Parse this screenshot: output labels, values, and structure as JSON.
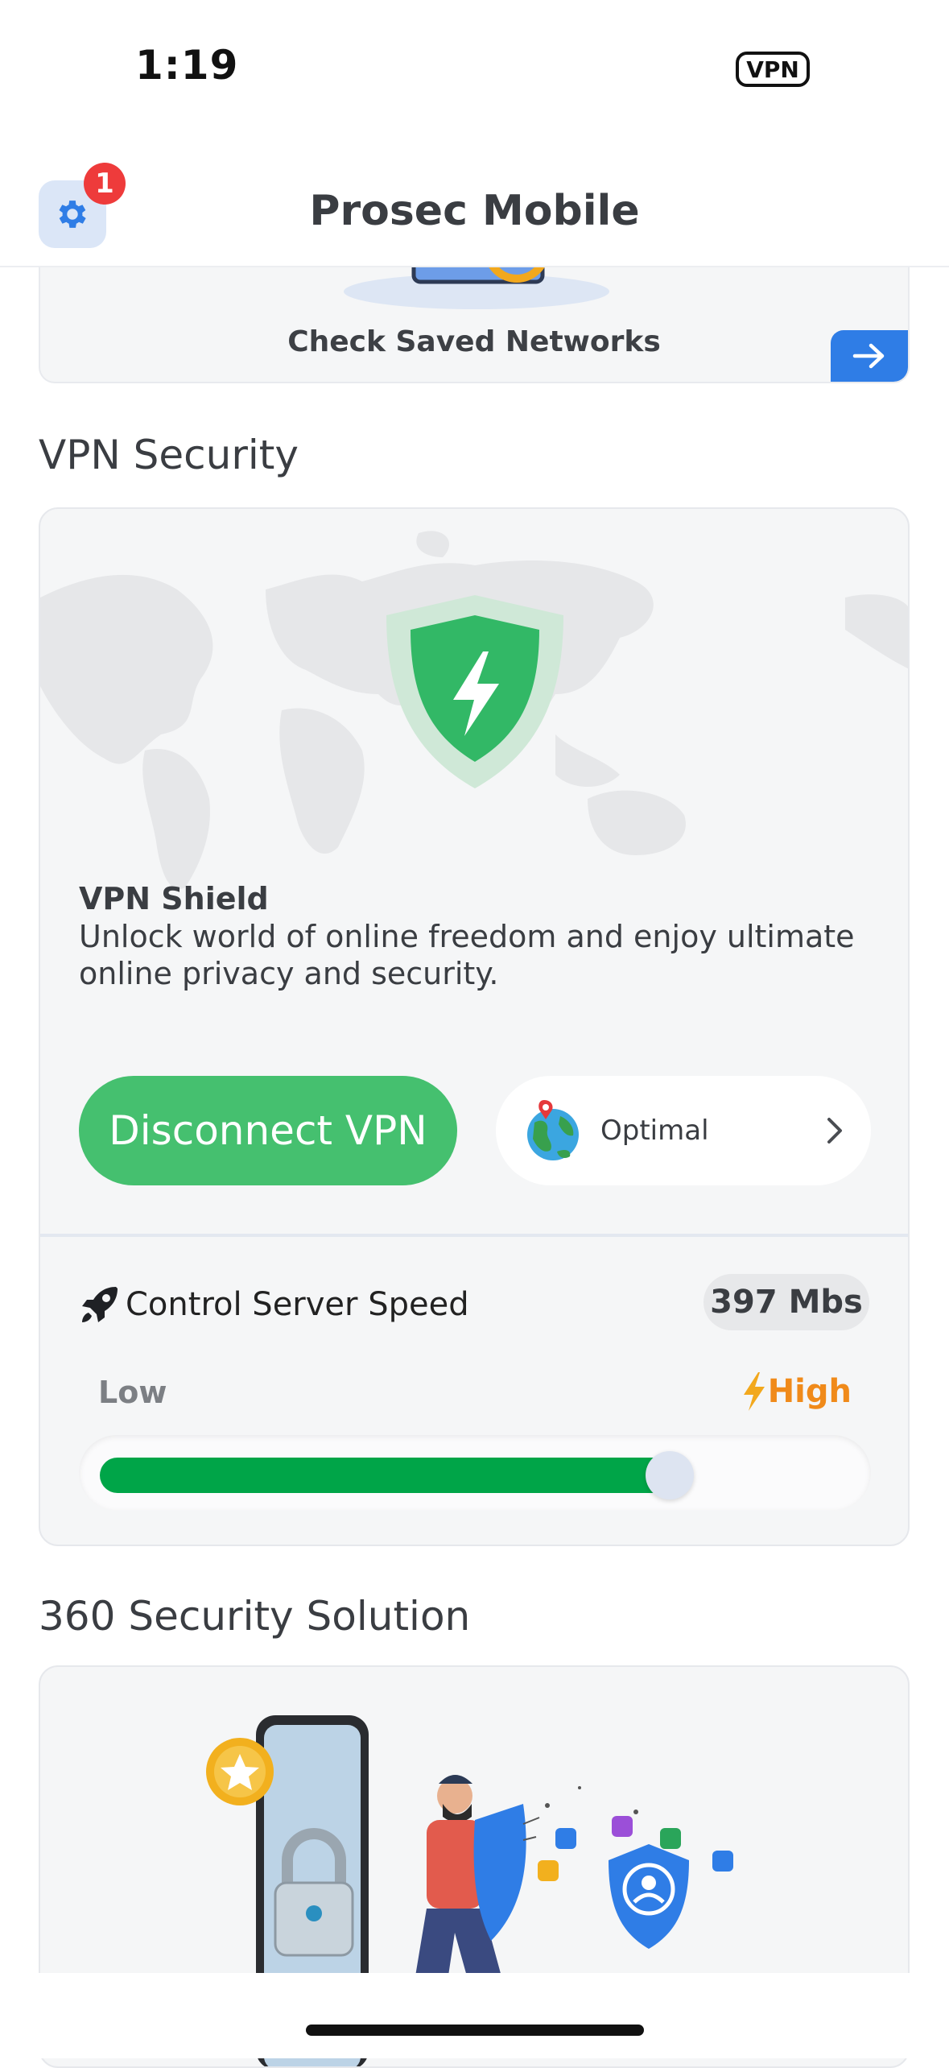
{
  "status_bar": {
    "time": "1:19",
    "vpn_indicator": "VPN"
  },
  "header": {
    "title": "Prosec Mobile",
    "settings_icon": "gear-icon",
    "notification_count": "1"
  },
  "saved_networks": {
    "title": "Check Saved Networks",
    "arrow_icon": "arrow-right-icon"
  },
  "vpn_section": {
    "title": "VPN Security",
    "shield_title": "VPN Shield",
    "shield_description": "Unlock world of online freedom and enjoy ultimate online privacy and security.",
    "disconnect_label": "Disconnect VPN",
    "location_label": "Optimal",
    "speed_title": "Control Server Speed",
    "speed_value": "397 Mbs",
    "low_label": "Low",
    "high_label": "High",
    "speed_level_fraction": 0.76,
    "colors": {
      "accent_green": "#45c06f",
      "slider_green": "#00a548",
      "high_orange": "#f08a1a"
    }
  },
  "security_section": {
    "title": "360 Security Solution"
  }
}
